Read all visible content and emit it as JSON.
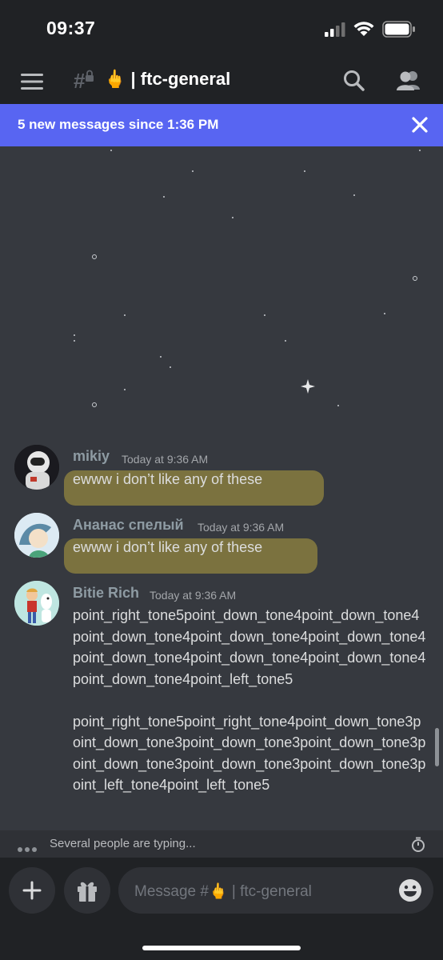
{
  "status_bar": {
    "time": "09:37"
  },
  "header": {
    "channel_emoji": "🖕",
    "channel_name": "| ftc-general"
  },
  "banner": {
    "text": "5 new messages since 1:36 PM"
  },
  "messages": [
    {
      "username": "mikiy",
      "timestamp": "Today at 9:36 AM",
      "text": "ewww i don’t like any of these",
      "avatar": "astronaut-avatar"
    },
    {
      "username": "Ананас спелый",
      "timestamp": "Today at 9:36 AM",
      "text": "ewww i don’t like any of these",
      "avatar": "anime-avatar"
    },
    {
      "username": "Bitie Rich",
      "timestamp": "Today at 9:36 AM",
      "text": "point_right_tone5point_down_tone4point_down_tone4point_down_tone4point_down_tone4point_down_tone4point_down_tone4point_down_tone4point_down_tone4point_down_tone4point_left_tone5\n\npoint_right_tone5point_right_tone4point_down_tone3point_down_tone3point_down_tone3point_down_tone3point_down_tone3point_down_tone3point_down_tone3point_left_tone4point_left_tone5",
      "avatar": "cartoon-avatar"
    }
  ],
  "typing": {
    "text": "Several people are typing..."
  },
  "composer": {
    "placeholder": "Message #🖕  |  ftc-general"
  },
  "colors": {
    "banner": "#5865f2",
    "background": "#36393f",
    "header": "#202225",
    "highlight": "#b5a23f"
  }
}
